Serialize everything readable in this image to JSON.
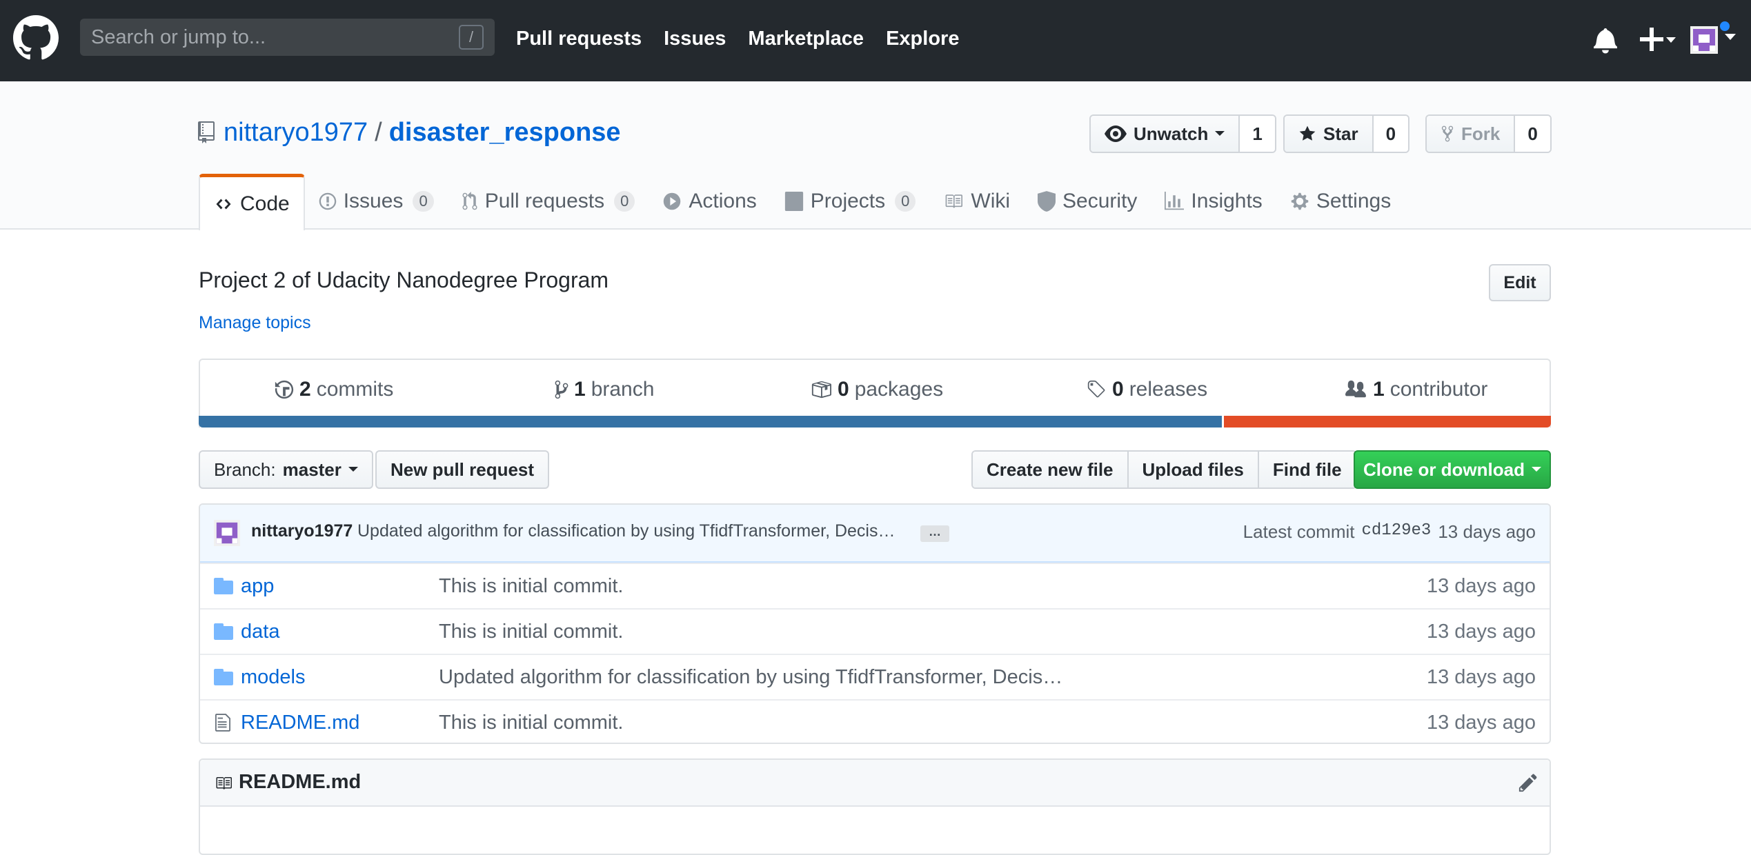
{
  "header": {
    "search_placeholder": "Search or jump to...",
    "search_shortcut": "/",
    "nav": [
      "Pull requests",
      "Issues",
      "Marketplace",
      "Explore"
    ]
  },
  "repo": {
    "owner": "nittaryo1977",
    "separator": "/",
    "name": "disaster_response",
    "watch": {
      "label": "Unwatch",
      "count": "1"
    },
    "star": {
      "label": "Star",
      "count": "0"
    },
    "fork": {
      "label": "Fork",
      "count": "0"
    }
  },
  "tabs": [
    {
      "label": "Code",
      "icon": "code-icon"
    },
    {
      "label": "Issues",
      "counter": "0",
      "icon": "issue-icon"
    },
    {
      "label": "Pull requests",
      "counter": "0",
      "icon": "pull-request-icon"
    },
    {
      "label": "Actions",
      "icon": "play-icon"
    },
    {
      "label": "Projects",
      "counter": "0",
      "icon": "project-icon"
    },
    {
      "label": "Wiki",
      "icon": "book-icon"
    },
    {
      "label": "Security",
      "icon": "shield-icon"
    },
    {
      "label": "Insights",
      "icon": "graph-icon"
    },
    {
      "label": "Settings",
      "icon": "gear-icon"
    }
  ],
  "about": {
    "description": "Project 2 of Udacity Nanodegree Program",
    "manage_topics": "Manage topics",
    "edit": "Edit"
  },
  "summary": {
    "commits": {
      "num": "2",
      "label": "commits"
    },
    "branches": {
      "num": "1",
      "label": "branch"
    },
    "packages": {
      "num": "0",
      "label": "packages"
    },
    "releases": {
      "num": "0",
      "label": "releases"
    },
    "contributors": {
      "num": "1",
      "label": "contributor"
    }
  },
  "languages": [
    {
      "color": "#3572a5",
      "percent": 75.8
    },
    {
      "color": "#e34c26",
      "percent": 24.2
    }
  ],
  "toolbar": {
    "branch_prefix": "Branch:",
    "branch": "master",
    "new_pr": "New pull request",
    "create_file": "Create new file",
    "upload": "Upload files",
    "find": "Find file",
    "clone": "Clone or download"
  },
  "latest_commit": {
    "author": "nittaryo1977",
    "message": "Updated algorithm for classification by using TfidfTransformer, Decis…",
    "ellipsis": "…",
    "prefix": "Latest commit",
    "sha": "cd129e3",
    "age": "13 days ago"
  },
  "files": [
    {
      "name": "app",
      "type": "folder",
      "message": "This is initial commit.",
      "age": "13 days ago"
    },
    {
      "name": "data",
      "type": "folder",
      "message": "This is initial commit.",
      "age": "13 days ago"
    },
    {
      "name": "models",
      "type": "folder",
      "message": "Updated algorithm for classification by using TfidfTransformer, Decis…",
      "age": "13 days ago"
    },
    {
      "name": "README.md",
      "type": "file",
      "message": "This is initial commit.",
      "age": "13 days ago"
    }
  ],
  "readme": {
    "title": "README.md"
  }
}
